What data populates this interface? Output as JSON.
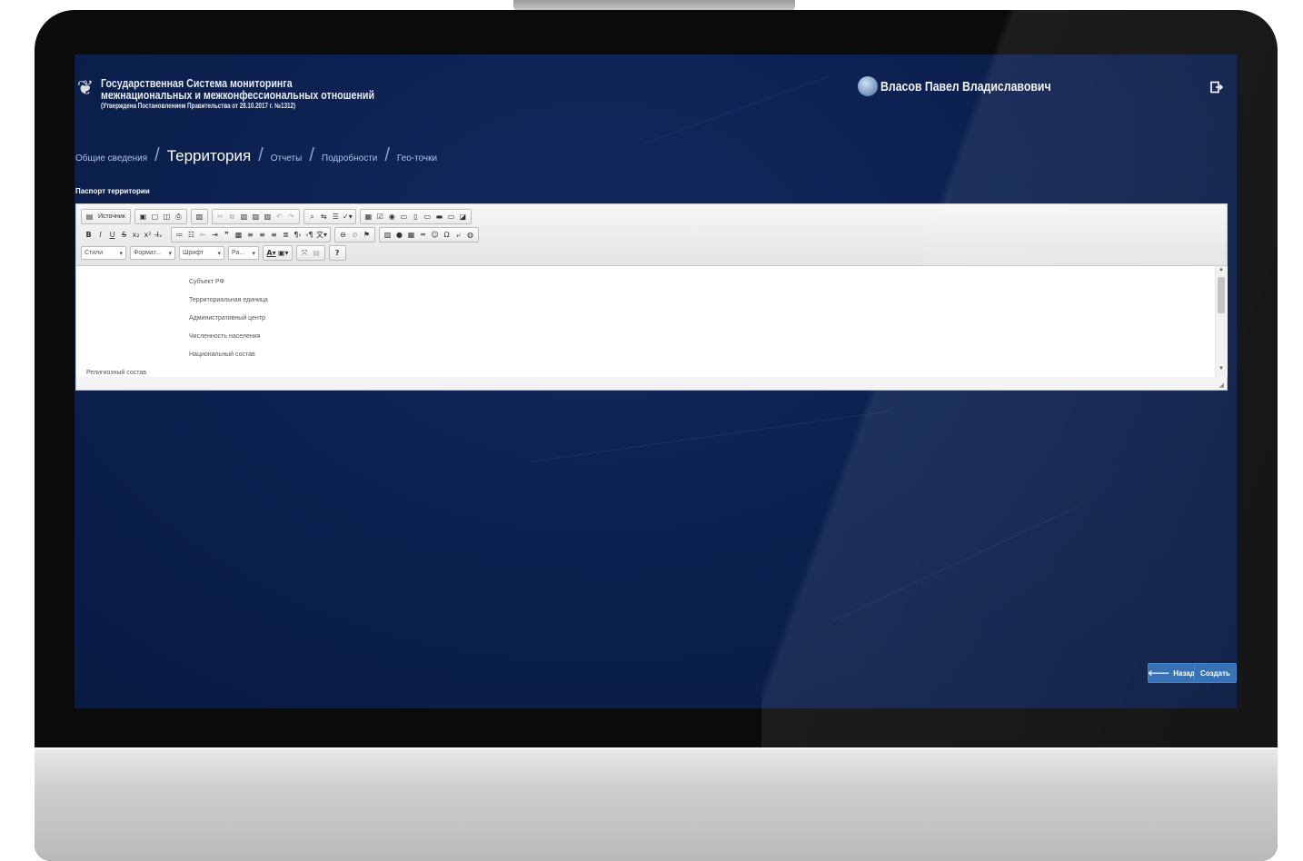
{
  "header": {
    "emblem_icon": "double-headed-eagle-icon",
    "title_line1": "Государственная Система мониторинга",
    "title_line2": "межнациональных и межконфессиональных отношений",
    "title_line3": "(Утверждена Постановлением Правительства от 28.10.2017 г. №1312)",
    "user_name": "Власов Павел Владиславович",
    "logout_icon": "logout-icon"
  },
  "breadcrumb": [
    {
      "label": "Общие сведения",
      "active": false
    },
    {
      "label": "Территория",
      "active": true
    },
    {
      "label": "Отчеты",
      "active": false
    },
    {
      "label": "Подробности",
      "active": false
    },
    {
      "label": "Гео-точки",
      "active": false
    }
  ],
  "breadcrumb_separator": "/",
  "section_label": "Паспорт территории",
  "editor": {
    "toolbar": {
      "source_label": "Источник",
      "styles_label": "Стили",
      "format_label": "Формат...",
      "font_label": "Шрифт",
      "size_label": "Ра...",
      "help_label": "?"
    },
    "fields": [
      "Субъект РФ",
      "Территориальная единица",
      "Административный центр",
      "Численность населения",
      "Национальный состав"
    ],
    "outer_field": "Религиозный состав"
  },
  "actions": {
    "back_label": "Назад",
    "back_icon": "arrow-left-icon",
    "create_label": "Создать"
  },
  "colors": {
    "screen_bg": "#0c2150",
    "accent_button": "#2d6cb0",
    "breadcrumb_link": "#a9c3ea"
  }
}
